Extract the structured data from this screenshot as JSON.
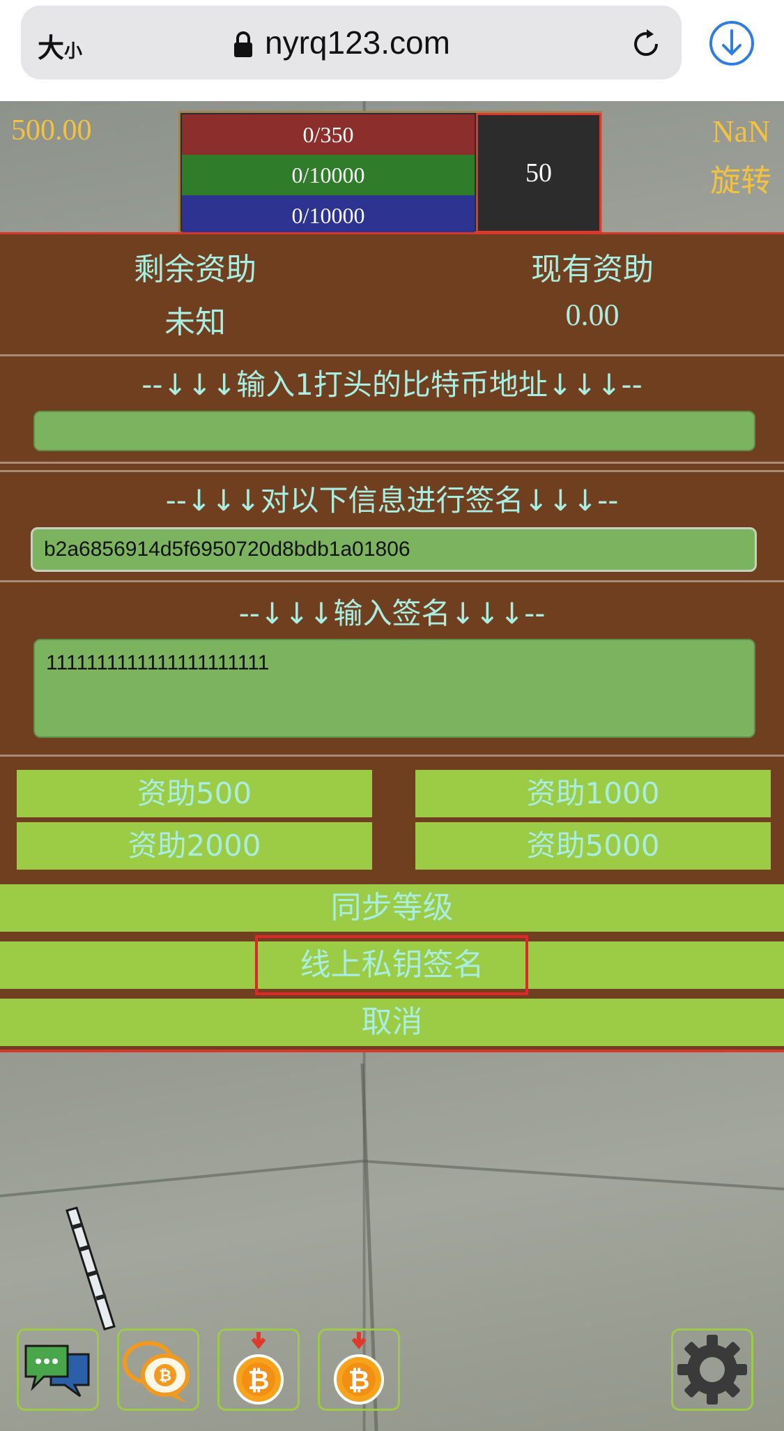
{
  "browser": {
    "text_size_big": "大",
    "text_size_small": "小",
    "url": "nyrq123.com"
  },
  "hud": {
    "money": "500.00",
    "nan_value": "NaN",
    "rotate_label": "旋转",
    "stat_red": "0/350",
    "stat_green": "0/10000",
    "stat_blue": "0/10000",
    "level": "50"
  },
  "panel": {
    "remaining_label": "剩余资助",
    "current_label": "现有资助",
    "remaining_value": "未知",
    "current_value": "0.00",
    "address_title": "--↓↓↓输入1打头的比特币地址↓↓↓--",
    "address_value": "",
    "sign_title": "--↓↓↓对以下信息进行签名↓↓↓--",
    "message_value": "b2a6856914d5f6950720d8bdb1a01806",
    "signature_title": "--↓↓↓输入签名↓↓↓--",
    "signature_value": "1111111111111111111111",
    "fund_500": "资助500",
    "fund_1000": "资助1000",
    "fund_2000": "资助2000",
    "fund_5000": "资助5000",
    "sync_level": "同步等级",
    "online_sign": "线上私钥签名",
    "cancel": "取消"
  },
  "icons": [
    "lock-icon",
    "reload-icon",
    "download-icon",
    "chat-icon",
    "bitcoin-chat-icon",
    "bitcoin-download-icon",
    "gear-icon"
  ],
  "colors": {
    "panel_bg": "#703f1f",
    "button_green": "#9ccb46",
    "text_cyan": "#a9eee0",
    "hud_gold": "#f3c242",
    "highlight_red": "#e0262b"
  }
}
